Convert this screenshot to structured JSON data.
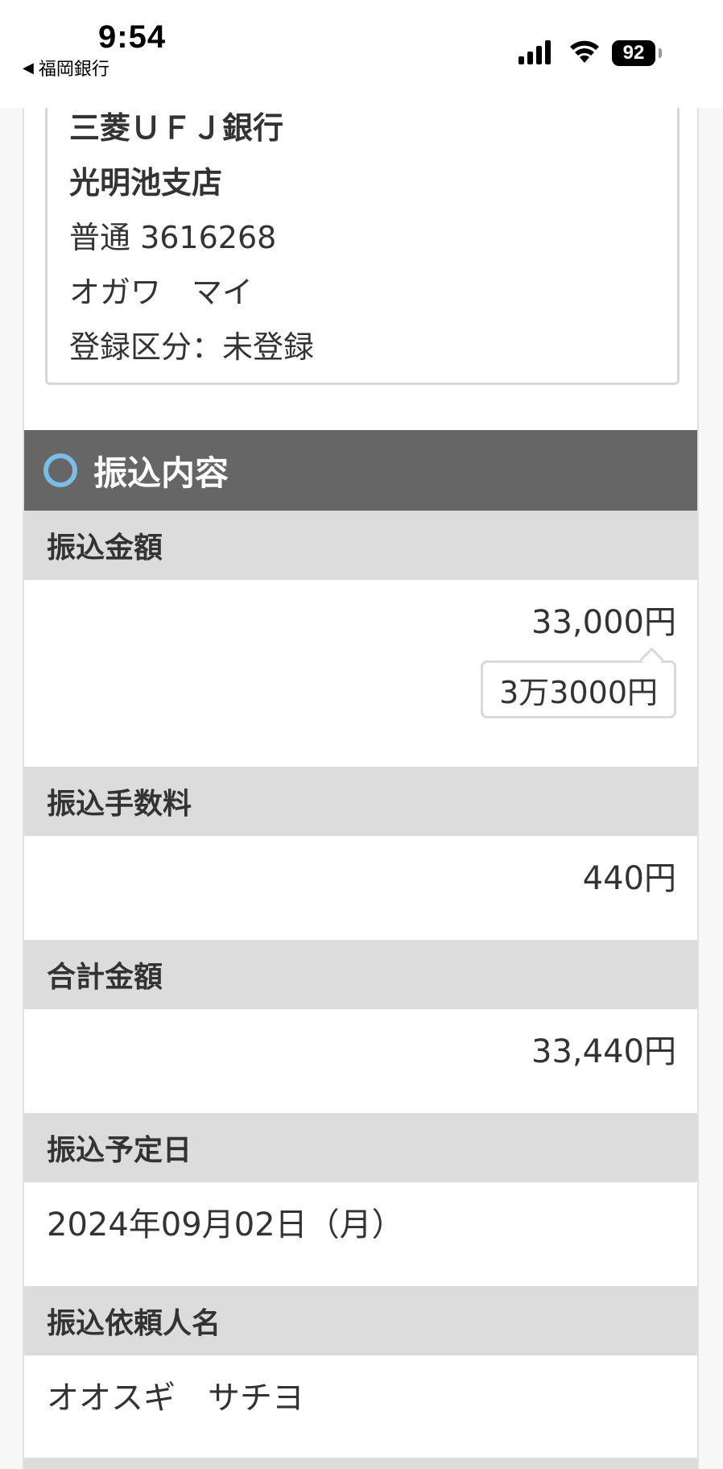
{
  "status_bar": {
    "time": "9:54",
    "back_app": "福岡銀行",
    "battery": "92"
  },
  "payee": {
    "bank": "三菱ＵＦＪ銀行",
    "branch": "光明池支店",
    "account": "普通 3616268",
    "name": "オガワ　マイ",
    "registration": "登録区分：未登録"
  },
  "section": {
    "title": "振込内容"
  },
  "fields": {
    "amount_label": "振込金額",
    "amount_value": "33,000円",
    "amount_kanji": "3万3000円",
    "fee_label": "振込手数料",
    "fee_value": "440円",
    "total_label": "合計金額",
    "total_value": "33,440円",
    "date_label": "振込予定日",
    "date_value": "2024年09月02日（月）",
    "requester_label": "振込依頼人名",
    "requester_value": "オオスギ　サチヨ"
  }
}
